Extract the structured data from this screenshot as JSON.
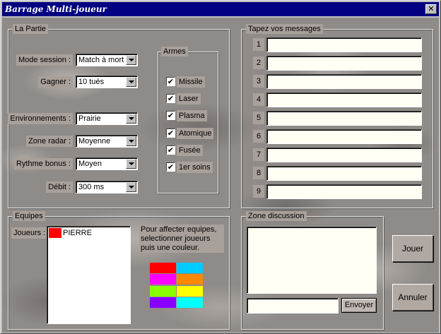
{
  "window": {
    "title": "Barrage Multi-joueur",
    "close_symbol": "✕"
  },
  "partie": {
    "title": "La Partie",
    "fields": [
      {
        "label": "Mode session :",
        "value": "Match à mort"
      },
      {
        "label": "Gagner :",
        "value": "10 tués"
      },
      {
        "label": "Environnements :",
        "value": "Prairie"
      },
      {
        "label": "Zone radar :",
        "value": "Moyenne"
      },
      {
        "label": "Rythme bonus :",
        "value": "Moyen"
      },
      {
        "label": "Débit :",
        "value": "300 ms"
      }
    ],
    "armes": {
      "title": "Armes",
      "items": [
        {
          "label": "Missile",
          "checked": true,
          "mark": "✔"
        },
        {
          "label": "Laser",
          "checked": true,
          "mark": "✔"
        },
        {
          "label": "Plasma",
          "checked": true,
          "mark": "✔"
        },
        {
          "label": "Atomique",
          "checked": true,
          "mark": "✔"
        },
        {
          "label": "Fusée",
          "checked": true,
          "mark": "✔"
        },
        {
          "label": "1er soins",
          "checked": true,
          "mark": "✔"
        }
      ]
    }
  },
  "messages": {
    "title": "Tapez vos messages",
    "rows": [
      {
        "num": "1",
        "value": ""
      },
      {
        "num": "2",
        "value": ""
      },
      {
        "num": "3",
        "value": ""
      },
      {
        "num": "4",
        "value": ""
      },
      {
        "num": "5",
        "value": ""
      },
      {
        "num": "6",
        "value": ""
      },
      {
        "num": "7",
        "value": ""
      },
      {
        "num": "8",
        "value": ""
      },
      {
        "num": "9",
        "value": ""
      }
    ]
  },
  "equipes": {
    "title": "Equipes",
    "players_label": "Joueurs :",
    "players": [
      {
        "name": "PIERRE",
        "color": "#ff0000"
      }
    ],
    "hint": "Pour affecter equipes, selectionner joueurs puis une couleur.",
    "colors": [
      "#ff0000",
      "#00ccff",
      "#ff00ff",
      "#ff8800",
      "#88ff00",
      "#ffff00",
      "#8800ff",
      "#00ffff"
    ]
  },
  "discussion": {
    "title": "Zone discussion",
    "input_value": "",
    "send_label": "Envoyer"
  },
  "buttons": {
    "join": "Jouer",
    "cancel": "Annuler"
  }
}
